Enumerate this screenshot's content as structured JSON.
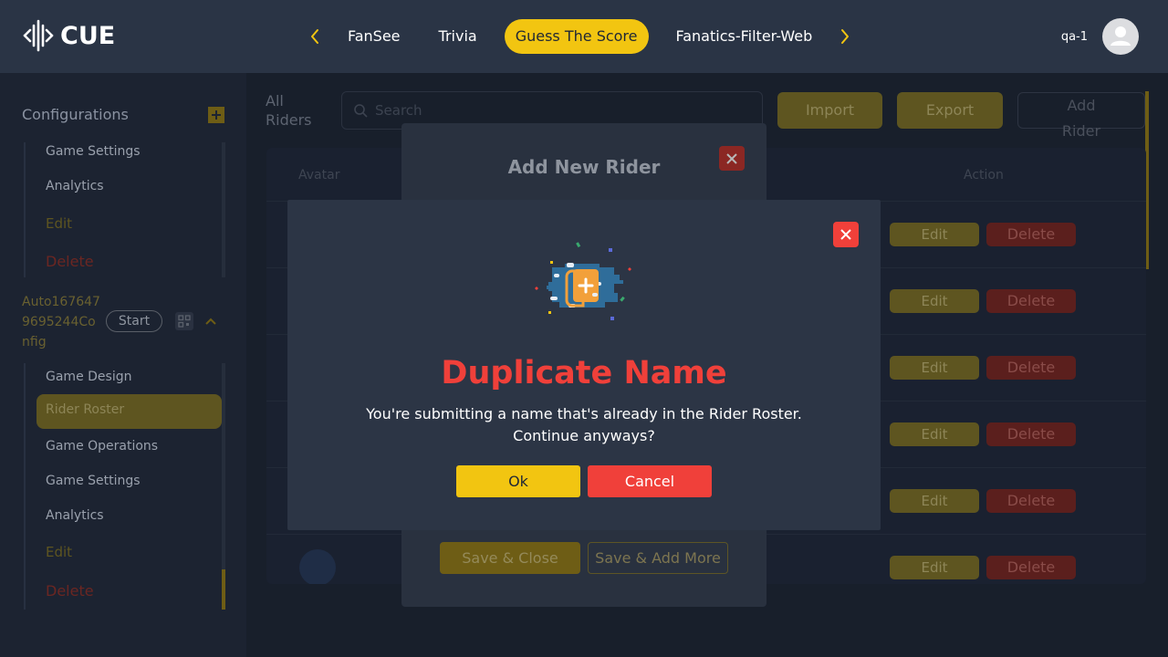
{
  "header": {
    "logo_text": "CUE",
    "nav_tabs": [
      {
        "label": "FanSee"
      },
      {
        "label": "Trivia"
      },
      {
        "label": "Guess The Score",
        "active": true
      },
      {
        "label": "Fanatics-Filter-Web"
      }
    ],
    "user_name": "qa-1"
  },
  "sidebar": {
    "title": "Configurations",
    "top_items": [
      "Game Settings",
      "Analytics",
      "Edit",
      "Delete"
    ],
    "config_name": "Auto1676479695244Config",
    "config_name_lines": [
      "Auto167647",
      "9695244Co",
      "nfig"
    ],
    "start_label": "Start",
    "config_items": [
      "Game Design",
      "Rider Roster",
      "Game Operations",
      "Game Settings",
      "Analytics",
      "Edit",
      "Delete"
    ]
  },
  "main": {
    "all_riders_lines": [
      "All",
      "Riders"
    ],
    "search_placeholder": "Search",
    "import_label": "Import",
    "export_label": "Export",
    "add_rider_lines": [
      "Add",
      "Rider"
    ],
    "table_headers": {
      "avatar": "Avatar",
      "action": "Action"
    },
    "row_edit": "Edit",
    "row_delete": "Delete"
  },
  "rider_modal": {
    "title": "Add New Rider",
    "save_close": "Save & Close",
    "save_add_more": "Save & Add More"
  },
  "dialog": {
    "title": "Duplicate Name",
    "message_line1": "You're submitting a name that's already in the Rider Roster.",
    "message_line2": "Continue anyways?",
    "ok_label": "Ok",
    "cancel_label": "Cancel"
  },
  "colors": {
    "accent": "#f2c511",
    "danger": "#f0403a",
    "header_bg": "#2a3445",
    "dialog_bg": "#2c3545"
  }
}
